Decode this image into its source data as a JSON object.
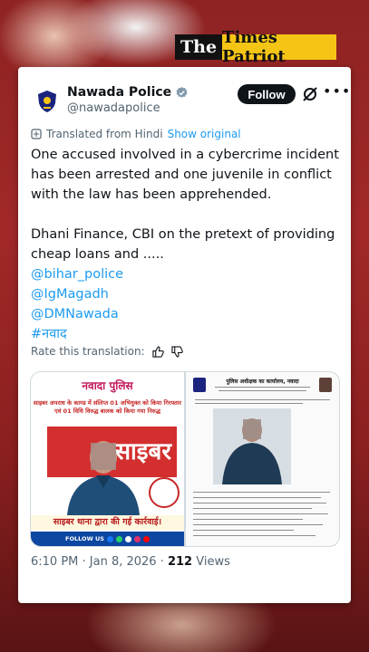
{
  "brand": {
    "the": "The",
    "name": "Times Patriot"
  },
  "account": {
    "name": "Nawada Police",
    "handle": "@nawadapolice",
    "verified": true,
    "follow_label": "Follow"
  },
  "translation": {
    "label": "Translated from Hindi",
    "show_original": "Show original"
  },
  "tweet": {
    "paragraph1": "One accused involved in a cybercrime incident has been arrested and one juvenile in conflict with the law has been apprehended.",
    "paragraph2": "Dhani Finance, CBI on the pretext of providing cheap loans and .....",
    "tags": [
      "@bihar_police",
      "@IgMagadh",
      "@DMNawada",
      "#नवाद"
    ]
  },
  "rate": {
    "label": "Rate this translation:"
  },
  "media": {
    "left": {
      "title": "नवादा पुलिस",
      "headline": "साइबर अपराध के काण्ड में संलिप्त 01 अभियुक्त को किया गिरफ्तार एवं 01 विधि विरुद्ध बालक को किया गया निरुद्ध",
      "banner_text": "साइबर",
      "caption": "साइबर थाना द्वारा की गई कार्रवाई।",
      "footer": "FOLLOW US"
    },
    "right": {
      "header": "पुलिस अधीक्षक का कार्यालय, नवादा"
    }
  },
  "meta": {
    "time": "6:10 PM · Jan 8, 2026 · ",
    "views_count": "212",
    "views_label": " Views"
  },
  "colors": {
    "link": "#1d9bf0",
    "follow_bg": "#0f1419",
    "brand_yellow": "#f5c516"
  }
}
